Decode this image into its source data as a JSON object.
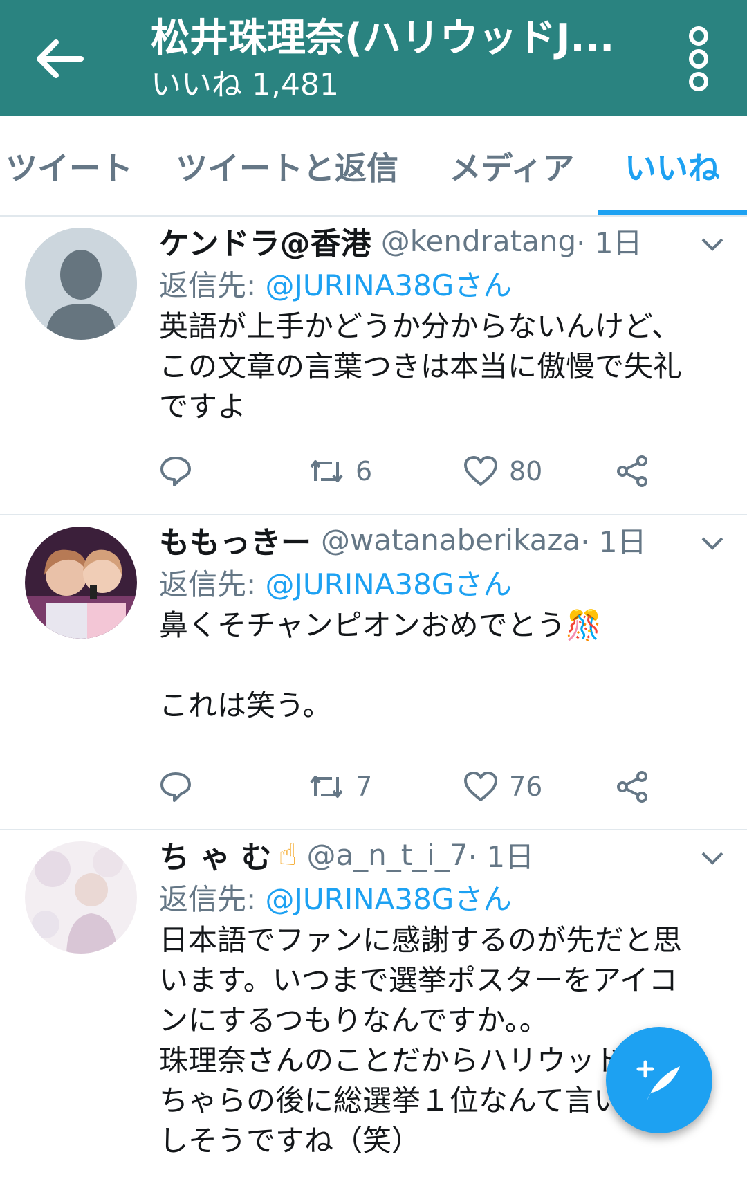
{
  "appbar": {
    "title": "松井珠理奈(ハリウッドJ...",
    "subtitle": "いいね 1,481"
  },
  "tabs": [
    {
      "label": "ツイート"
    },
    {
      "label": "ツイートと返信"
    },
    {
      "label": "メディア"
    },
    {
      "label": "いいね"
    }
  ],
  "active_tab": "いいね",
  "colors": {
    "appbar": "#2a8380",
    "accent": "#1da1f2",
    "muted": "#657786"
  },
  "tweets": [
    {
      "name": "ケンドラ@香港",
      "handle": "@kendratang",
      "time": " · 1日",
      "reply_label": "返信先: ",
      "reply_user": "@JURINA38Gさん",
      "text": "英語が上手かどうか分からないんけど、\nこの文章の言葉つきは本当に傲慢で失礼\nですよ",
      "retweets": "6",
      "likes": "80",
      "avatar": "default-profile-icon"
    },
    {
      "name": "ももっきー",
      "handle": "@watanaberikaza",
      "time": " · 1日",
      "reply_label": "返信先: ",
      "reply_user": "@JURINA38Gさん",
      "text": "鼻くそチャンピオンおめでとう🎊\n\nこれは笑う。",
      "retweets": "7",
      "likes": "76",
      "avatar": "photo-avatar"
    },
    {
      "name": "ち ゃ む",
      "name_emoji": "☝",
      "handle": "@a_n_t_i_7",
      "time": " · 1日",
      "reply_label": "返信先: ",
      "reply_user": "@JURINA38Gさん",
      "text": "日本語でファンに感謝するのが先だと思\nいます。いつまで選挙ポスターをアイコ\nンにするつもりなんですか。。\n珠理奈さんのことだからハリウッドのあ\nちゃらの後に総選挙１位なんて言いそう\nしそうですね（笑）",
      "avatar": "photo-avatar"
    }
  ],
  "icons": {
    "back": "arrow-left-icon",
    "more": "more-vertical-icon",
    "reply": "reply-icon",
    "retweet": "retweet-icon",
    "like": "heart-icon",
    "share": "share-icon",
    "compose": "compose-tweet-icon"
  }
}
